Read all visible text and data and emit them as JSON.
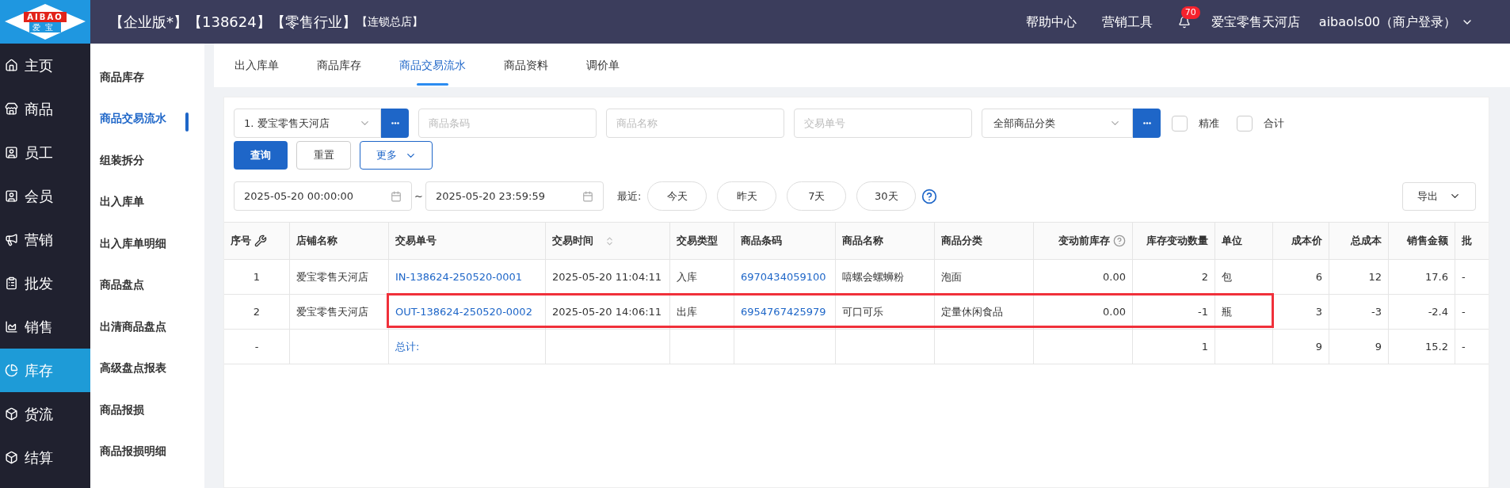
{
  "logo": {
    "text": "AIBAO",
    "subtext": "爱宝"
  },
  "header": {
    "title": "【企业版*】【138624】【零售行业】",
    "subtitle": "【连锁总店】",
    "links": [
      "帮助中心",
      "营销工具"
    ],
    "notifications": "70",
    "store": "爱宝零售天河店",
    "user": "aibaols00（商户登录）"
  },
  "sidebar": {
    "items": [
      {
        "label": "主页",
        "selected": false
      },
      {
        "label": "商品",
        "selected": false
      },
      {
        "label": "员工",
        "selected": false
      },
      {
        "label": "会员",
        "selected": false
      },
      {
        "label": "营销",
        "selected": false
      },
      {
        "label": "批发",
        "selected": false
      },
      {
        "label": "销售",
        "selected": false
      },
      {
        "label": "库存",
        "selected": true
      },
      {
        "label": "货流",
        "selected": false
      },
      {
        "label": "结算",
        "selected": false
      }
    ]
  },
  "submenu": {
    "items": [
      {
        "label": "商品库存",
        "selected": false
      },
      {
        "label": "商品交易流水",
        "selected": true
      },
      {
        "label": "组装拆分",
        "selected": false
      },
      {
        "label": "出入库单",
        "selected": false
      },
      {
        "label": "出入库单明细",
        "selected": false
      },
      {
        "label": "商品盘点",
        "selected": false
      },
      {
        "label": "出清商品盘点",
        "selected": false
      },
      {
        "label": "高级盘点报表",
        "selected": false
      },
      {
        "label": "商品报损",
        "selected": false
      },
      {
        "label": "商品报损明细",
        "selected": false
      }
    ]
  },
  "tabs": [
    {
      "label": "出入库单",
      "selected": false
    },
    {
      "label": "商品库存",
      "selected": false
    },
    {
      "label": "商品交易流水",
      "selected": true
    },
    {
      "label": "商品资料",
      "selected": false
    },
    {
      "label": "调价单",
      "selected": false
    }
  ],
  "filters": {
    "store": "1. 爱宝零售天河店",
    "barcode": {
      "placeholder": "商品条码"
    },
    "name": {
      "placeholder": "商品名称"
    },
    "order_no": {
      "placeholder": "交易单号"
    },
    "category": "全部商品分类",
    "checkboxes": [
      {
        "label": "精准",
        "checked": false
      },
      {
        "label": "合计",
        "checked": false
      }
    ],
    "buttons": [
      "查询",
      "重置",
      "更多"
    ],
    "date_from": "2025-05-20 00:00:00",
    "date_sep": "~",
    "date_to": "2025-05-20 23:59:59",
    "recent_label": "最近:",
    "recent": [
      "今天",
      "昨天",
      "7天",
      "30天"
    ],
    "export": "导出"
  },
  "table": {
    "columns": [
      {
        "label": "序号",
        "kind": "settings",
        "link": false,
        "numeric": false
      },
      {
        "label": "店铺名称",
        "kind": "plain",
        "link": false,
        "numeric": false
      },
      {
        "label": "交易单号",
        "kind": "plain",
        "link": true,
        "numeric": false
      },
      {
        "label": "交易时间",
        "kind": "sortable",
        "link": false,
        "numeric": false
      },
      {
        "label": "交易类型",
        "kind": "plain",
        "link": false,
        "numeric": false
      },
      {
        "label": "商品条码",
        "kind": "plain",
        "link": true,
        "numeric": false
      },
      {
        "label": "商品名称",
        "kind": "plain",
        "link": false,
        "numeric": false
      },
      {
        "label": "商品分类",
        "kind": "plain",
        "link": false,
        "numeric": false
      },
      {
        "label": "变动前库存",
        "kind": "help",
        "link": false,
        "numeric": true
      },
      {
        "label": "库存变动数量",
        "kind": "plain",
        "link": false,
        "numeric": true
      },
      {
        "label": "单位",
        "kind": "plain",
        "link": false,
        "numeric": false
      },
      {
        "label": "成本价",
        "kind": "plain",
        "link": false,
        "numeric": true
      },
      {
        "label": "总成本",
        "kind": "plain",
        "link": false,
        "numeric": true
      },
      {
        "label": "销售金额",
        "kind": "plain",
        "link": false,
        "numeric": true
      },
      {
        "label": "批",
        "kind": "plain",
        "link": false,
        "numeric": false
      }
    ],
    "rows": [
      {
        "highlighted": false,
        "cells": [
          "1",
          "爱宝零售天河店",
          "IN-138624-250520-0001",
          "2025-05-20 11:04:11",
          "入库",
          "6970434059100",
          "嘻螺会螺蛳粉",
          "泡面",
          "0.00",
          "2",
          "包",
          "6",
          "12",
          "17.6",
          "-"
        ]
      },
      {
        "highlighted": true,
        "cells": [
          "2",
          "爱宝零售天河店",
          "OUT-138624-250520-0002",
          "2025-05-20 14:06:11",
          "出库",
          "6954767425979",
          "可口可乐",
          "定量休闲食品",
          "0.00",
          "-1",
          "瓶",
          "3",
          "-3",
          "-2.4",
          "-"
        ]
      },
      {
        "highlighted": false,
        "cells": [
          "-",
          "",
          "总计:",
          "",
          "",
          "",
          "",
          "",
          "",
          "1",
          "",
          "9",
          "9",
          "15.2",
          "-"
        ]
      }
    ]
  }
}
